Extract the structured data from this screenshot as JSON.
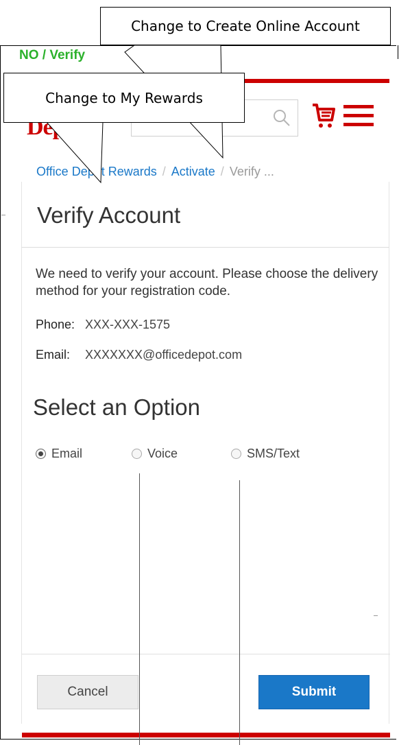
{
  "annotations": {
    "status_note": "NO / Verify",
    "callout_top": "Change to Create Online Account",
    "callout_left": "Change to My Rewards"
  },
  "header": {
    "logo_text": "Depot",
    "cart_icon": "cart-icon",
    "menu_icon": "hamburger-menu-icon",
    "search_icon": "search-icon",
    "brand_color": "#cc0000"
  },
  "breadcrumb": {
    "items": [
      "Office Depot Rewards",
      "Activate",
      "Verify ..."
    ],
    "separator": "/"
  },
  "page": {
    "title": "Verify Account",
    "intro": "We need to verify your account. Please choose the delivery method for your registration code.",
    "phone_label": "Phone:",
    "phone_value": "XXX-XXX-1575",
    "email_label": "Email:",
    "email_value": "XXXXXXX@officedepot.com",
    "options_heading": "Select an Option"
  },
  "options": [
    {
      "label": "Email",
      "selected": true
    },
    {
      "label": "Voice",
      "selected": false
    },
    {
      "label": "SMS/Text",
      "selected": false
    }
  ],
  "actions": {
    "cancel_label": "Cancel",
    "submit_label": "Submit",
    "submit_color": "#1a78c8"
  }
}
